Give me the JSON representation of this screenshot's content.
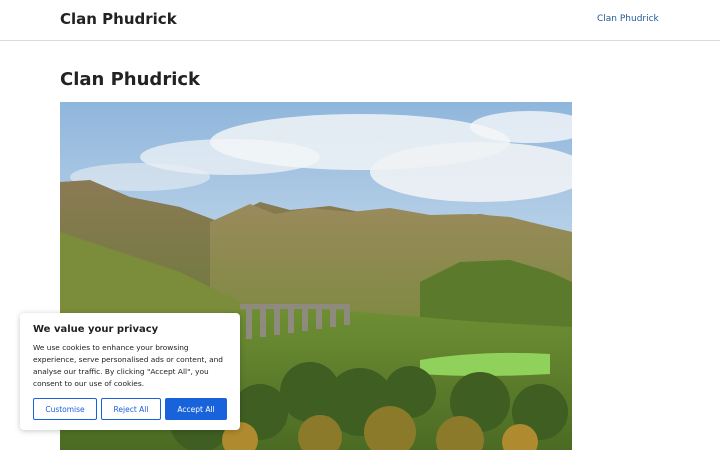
{
  "header": {
    "site_title": "Clan Phudrick",
    "nav": [
      {
        "label": "Clan Phudrick"
      }
    ]
  },
  "main": {
    "page_title": "Clan Phudrick"
  },
  "cookie_banner": {
    "title": "We value your privacy",
    "text": "We use cookies to enhance your browsing experience, serve personalised ads or content, and analyse our traffic. By clicking \"Accept All\", you consent to our use of cookies.",
    "buttons": {
      "customise": "Customise",
      "reject": "Reject All",
      "accept": "Accept All"
    },
    "accent_color": "#1863dc"
  },
  "colors": {
    "link": "#1e5a96",
    "text": "#222222"
  }
}
